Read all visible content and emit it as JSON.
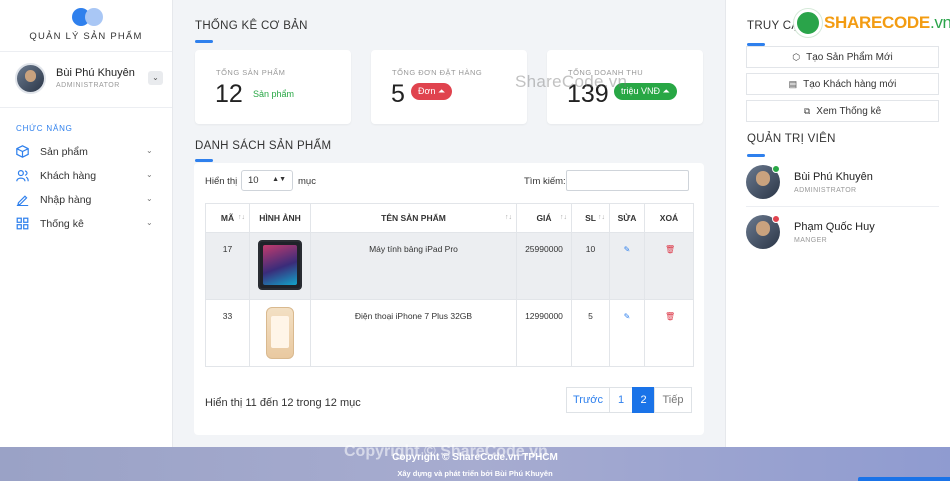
{
  "sidebar": {
    "brand": "QUẢN LÝ SẢN PHẨM",
    "user": {
      "name": "Bùi Phú Khuyên",
      "role": "ADMINISTRATOR"
    },
    "nav_header": "CHỨC NĂNG",
    "items": [
      {
        "label": "Sản phẩm",
        "icon": "box-icon"
      },
      {
        "label": "Khách hàng",
        "icon": "users-icon"
      },
      {
        "label": "Nhập hàng",
        "icon": "pencil-icon"
      },
      {
        "label": "Thống kê",
        "icon": "grid-icon"
      }
    ]
  },
  "stats": {
    "title": "THỐNG KÊ CƠ BẢN",
    "cards": [
      {
        "label": "TỔNG SẢN PHẨM",
        "value": "12",
        "note": "Sản phẩm"
      },
      {
        "label": "TỔNG ĐƠN ĐẶT HÀNG",
        "value": "5",
        "note": "Đơn",
        "note_color": "#e0434e"
      },
      {
        "label": "TỔNG DOANH THU",
        "value": "139",
        "note": "triệu VNĐ",
        "note_color": "#28a745"
      }
    ]
  },
  "products": {
    "title": "DANH SÁCH SẢN PHẨM",
    "length_label_before": "Hiển thị",
    "length_value": "10",
    "length_label_after": "mục",
    "search_label": "Tìm kiếm:",
    "search_value": "",
    "columns": [
      "MÃ",
      "HÌNH ẢNH",
      "TÊN SẢN PHẨM",
      "GIÁ",
      "SL",
      "SỬA",
      "XOÁ"
    ],
    "rows": [
      {
        "id": "17",
        "name": "Máy tính bảng iPad Pro",
        "price": "25990000",
        "qty": "10",
        "image": "ipad-pro-image"
      },
      {
        "id": "33",
        "name": "Điện thoại iPhone 7 Plus 32GB",
        "price": "12990000",
        "qty": "5",
        "image": "iphone-7-plus-image"
      }
    ],
    "info": "Hiển thị 11 đến 12 trong 12 mục",
    "pagination": {
      "prev": "Trước",
      "pages": [
        "1",
        "2"
      ],
      "active": "2",
      "next": "Tiếp"
    }
  },
  "quick": {
    "title": "TRUY CẬ",
    "buttons": [
      {
        "label": "Tạo Sản Phẩm Mới",
        "icon": "box-icon"
      },
      {
        "label": "Tạo Khách hàng mới",
        "icon": "id-card-icon"
      },
      {
        "label": "Xem Thống kê",
        "icon": "chart-icon"
      }
    ]
  },
  "admins": {
    "title": "QUẢN TRỊ VIÊN",
    "list": [
      {
        "name": "Bùi Phú Khuyên",
        "role": "ADMINISTRATOR",
        "status_color": "#28a745"
      },
      {
        "name": "Phạm Quốc Huy",
        "role": "MANGER",
        "status_color": "#e0434e"
      }
    ]
  },
  "watermark": {
    "logo_main": "SHARECODE",
    "logo_suffix": ".vn",
    "text": "ShareCode.vn"
  },
  "footer": {
    "line1": "Copyright © ShareCode.vn TPHCM",
    "line2": "Xây dựng và phát triển bởi Bùi Phú Khuyên",
    "watermark": "Copyright © ShareCode.vn"
  },
  "colors": {
    "accent": "#2f80ed",
    "success": "#28a745",
    "danger": "#e0434e",
    "active_page": "#1a73e8"
  }
}
